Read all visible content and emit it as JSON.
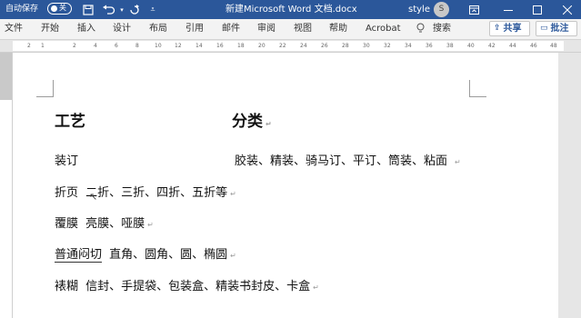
{
  "titlebar": {
    "autosave_label": "自动保存",
    "autosave_state": "关",
    "doc_title": "新建Microsoft Word 文档.docx",
    "user_name": "style",
    "avatar_initial": "S",
    "bg_color": "#2b579a"
  },
  "ribbon": {
    "tabs": [
      "文件",
      "开始",
      "插入",
      "设计",
      "布局",
      "引用",
      "邮件",
      "审阅",
      "视图",
      "帮助",
      "Acrobat"
    ],
    "search_label": "搜索",
    "share_label": "共享",
    "comment_label": "批注"
  },
  "ruler": {
    "ticks": [
      "2",
      "1",
      "2",
      "4",
      "6",
      "8",
      "10",
      "12",
      "14",
      "16",
      "18",
      "20",
      "22",
      "24",
      "26",
      "28",
      "30",
      "32",
      "34",
      "36",
      "38",
      "40",
      "42",
      "44",
      "46",
      "48"
    ]
  },
  "document": {
    "heading_left": "工艺",
    "heading_right": "分类",
    "rows": [
      {
        "term": "装订",
        "desc": "胶装、精装、骑马订、平订、筒装、粘面"
      },
      {
        "term": "折页",
        "desc": "二折、三折、四折、五折等"
      },
      {
        "term": "覆膜",
        "desc": "亮膜、哑膜"
      },
      {
        "term": "普通闷切",
        "desc": "直角、圆角、圆、椭圆"
      },
      {
        "term": "裱糊",
        "desc": "信封、手提袋、包装盒、精装书封皮、卡盒"
      }
    ],
    "paragraph_mark": "↵"
  }
}
